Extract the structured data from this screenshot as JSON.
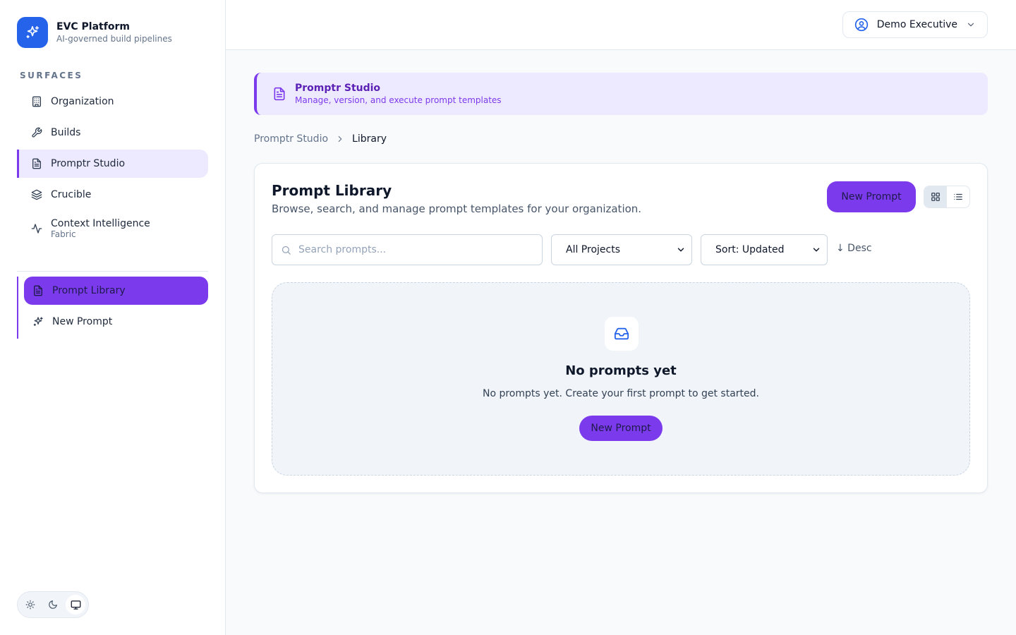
{
  "brand": {
    "name": "EVC Platform",
    "subtitle": "AI-governed build pipelines"
  },
  "sidebar": {
    "section_label": "SURFACES",
    "items": [
      {
        "label": "Organization",
        "icon": "building-icon"
      },
      {
        "label": "Builds",
        "icon": "wrench-icon"
      },
      {
        "label": "Promptr Studio",
        "icon": "file-text-icon",
        "active": true
      },
      {
        "label": "Crucible",
        "icon": "layers-icon"
      },
      {
        "label": "Context Intelligence",
        "sub": "Fabric",
        "icon": "activity-icon"
      }
    ],
    "subnav": [
      {
        "label": "Prompt Library",
        "icon": "file-text-icon",
        "active": true
      },
      {
        "label": "New Prompt",
        "icon": "sparkles-icon"
      }
    ],
    "theme": {
      "options": [
        "light",
        "dark",
        "system"
      ],
      "selected": "system"
    }
  },
  "topbar": {
    "user": "Demo Executive"
  },
  "banner": {
    "title": "Promptr Studio",
    "subtitle": "Manage, version, and execute prompt templates"
  },
  "breadcrumb": {
    "parent": "Promptr Studio",
    "current": "Library"
  },
  "library": {
    "title": "Prompt Library",
    "subtitle": "Browse, search, and manage prompt templates for your organization.",
    "new_button": "New Prompt",
    "view_mode": "grid",
    "search_placeholder": "Search prompts...",
    "project_filter": "All Projects",
    "sort": "Sort: Updated",
    "sort_direction": "↓ Desc"
  },
  "empty_state": {
    "title": "No prompts yet",
    "message": "No prompts yet. Create your first prompt to get started.",
    "button": "New Prompt"
  },
  "colors": {
    "accent": "#7c3aed",
    "brand": "#2563eb",
    "accent_light": "#ede9fe"
  }
}
